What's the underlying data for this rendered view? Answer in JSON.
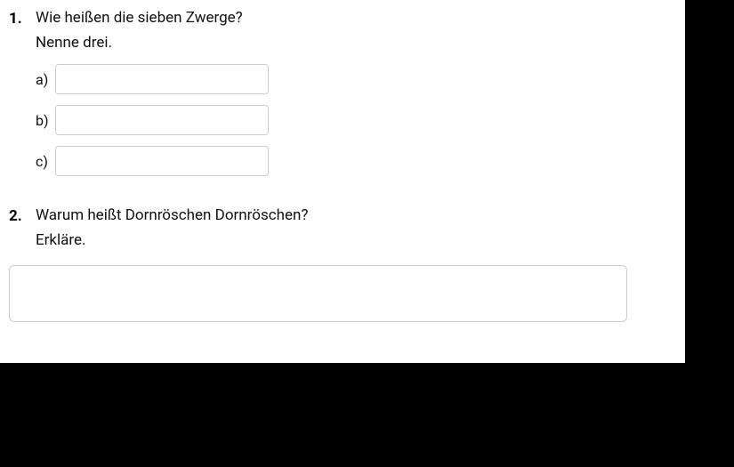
{
  "questions": [
    {
      "number": "1.",
      "title": "Wie heißen die sieben Zwerge?",
      "instruction": "Nenne drei.",
      "answers": [
        {
          "label": "a)",
          "value": ""
        },
        {
          "label": "b)",
          "value": ""
        },
        {
          "label": "c)",
          "value": ""
        }
      ]
    },
    {
      "number": "2.",
      "title": "Warum heißt Dornröschen Dornröschen?",
      "instruction": "Erkläre.",
      "textarea_value": ""
    }
  ]
}
